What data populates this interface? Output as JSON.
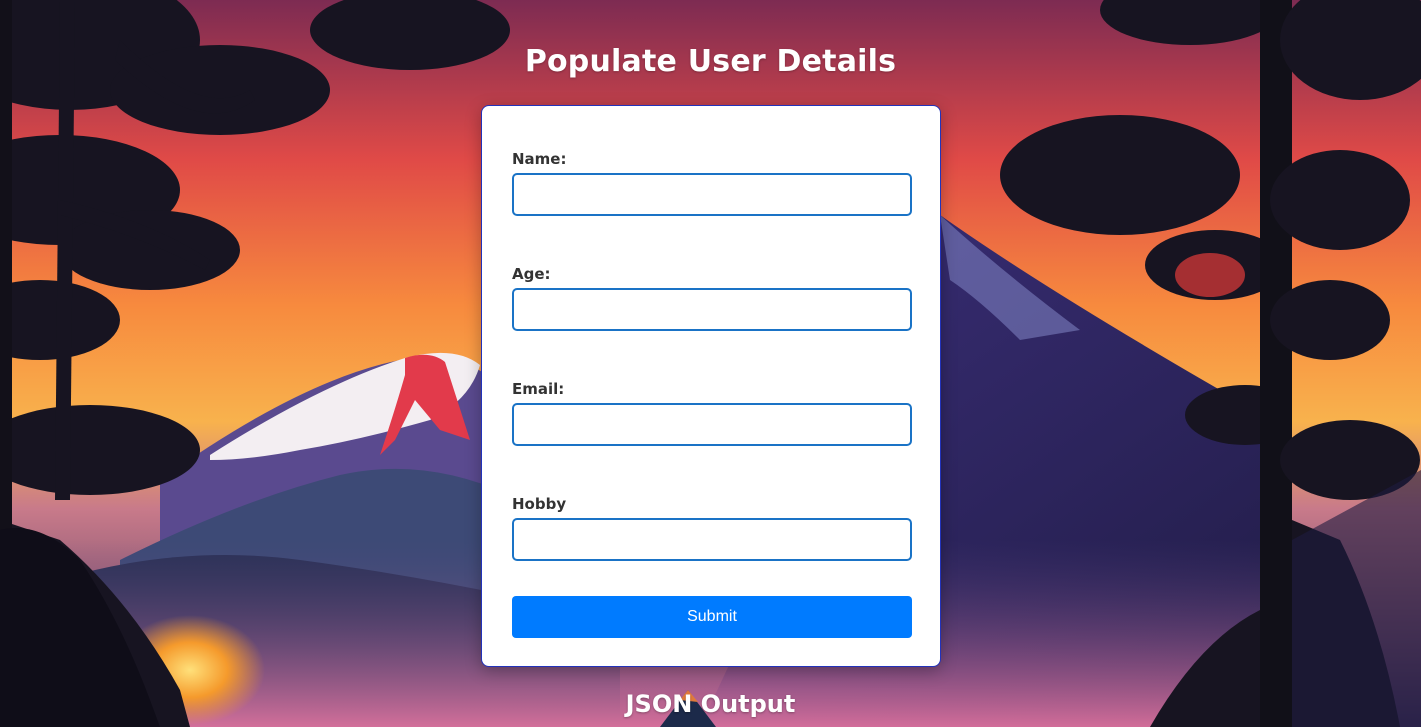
{
  "page": {
    "title": "Populate User Details",
    "json_output_heading": "JSON Output"
  },
  "form": {
    "fields": [
      {
        "label": "Name:",
        "value": ""
      },
      {
        "label": "Age:",
        "value": ""
      },
      {
        "label": "Email:",
        "value": ""
      },
      {
        "label": "Hobby",
        "value": ""
      }
    ],
    "submit_label": "Submit"
  },
  "colors": {
    "accent": "#007bff",
    "input_border": "#1a73c6",
    "card_border": "#2233bb",
    "label_text": "#333333"
  },
  "background": {
    "description_icon": "mountain-sunset-landscape"
  }
}
